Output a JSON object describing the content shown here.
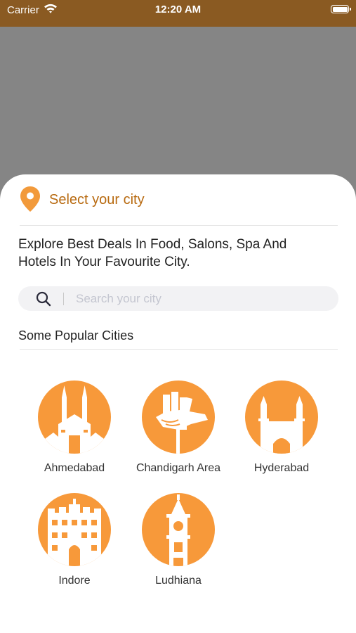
{
  "status_bar": {
    "carrier": "Carrier",
    "time": "12:20 AM"
  },
  "sheet": {
    "title": "Select your city",
    "description": "Explore Best Deals In Food, Salons, Spa And Hotels In Your Favourite City.",
    "search_placeholder": "Search your city",
    "popular_title": "Some Popular Cities",
    "cities": [
      {
        "name": "Ahmedabad",
        "icon": "ahmedabad-mosque-icon"
      },
      {
        "name": "Chandigarh Area",
        "icon": "chandigarh-open-hand-icon"
      },
      {
        "name": "Hyderabad",
        "icon": "hyderabad-charminar-icon"
      },
      {
        "name": "Indore",
        "icon": "indore-palace-icon"
      },
      {
        "name": "Ludhiana",
        "icon": "ludhiana-clock-tower-icon"
      }
    ]
  },
  "colors": {
    "status_bar": "#8a5a22",
    "accent": "#f7993a",
    "title": "#b86a10",
    "backdrop": "#858585"
  }
}
